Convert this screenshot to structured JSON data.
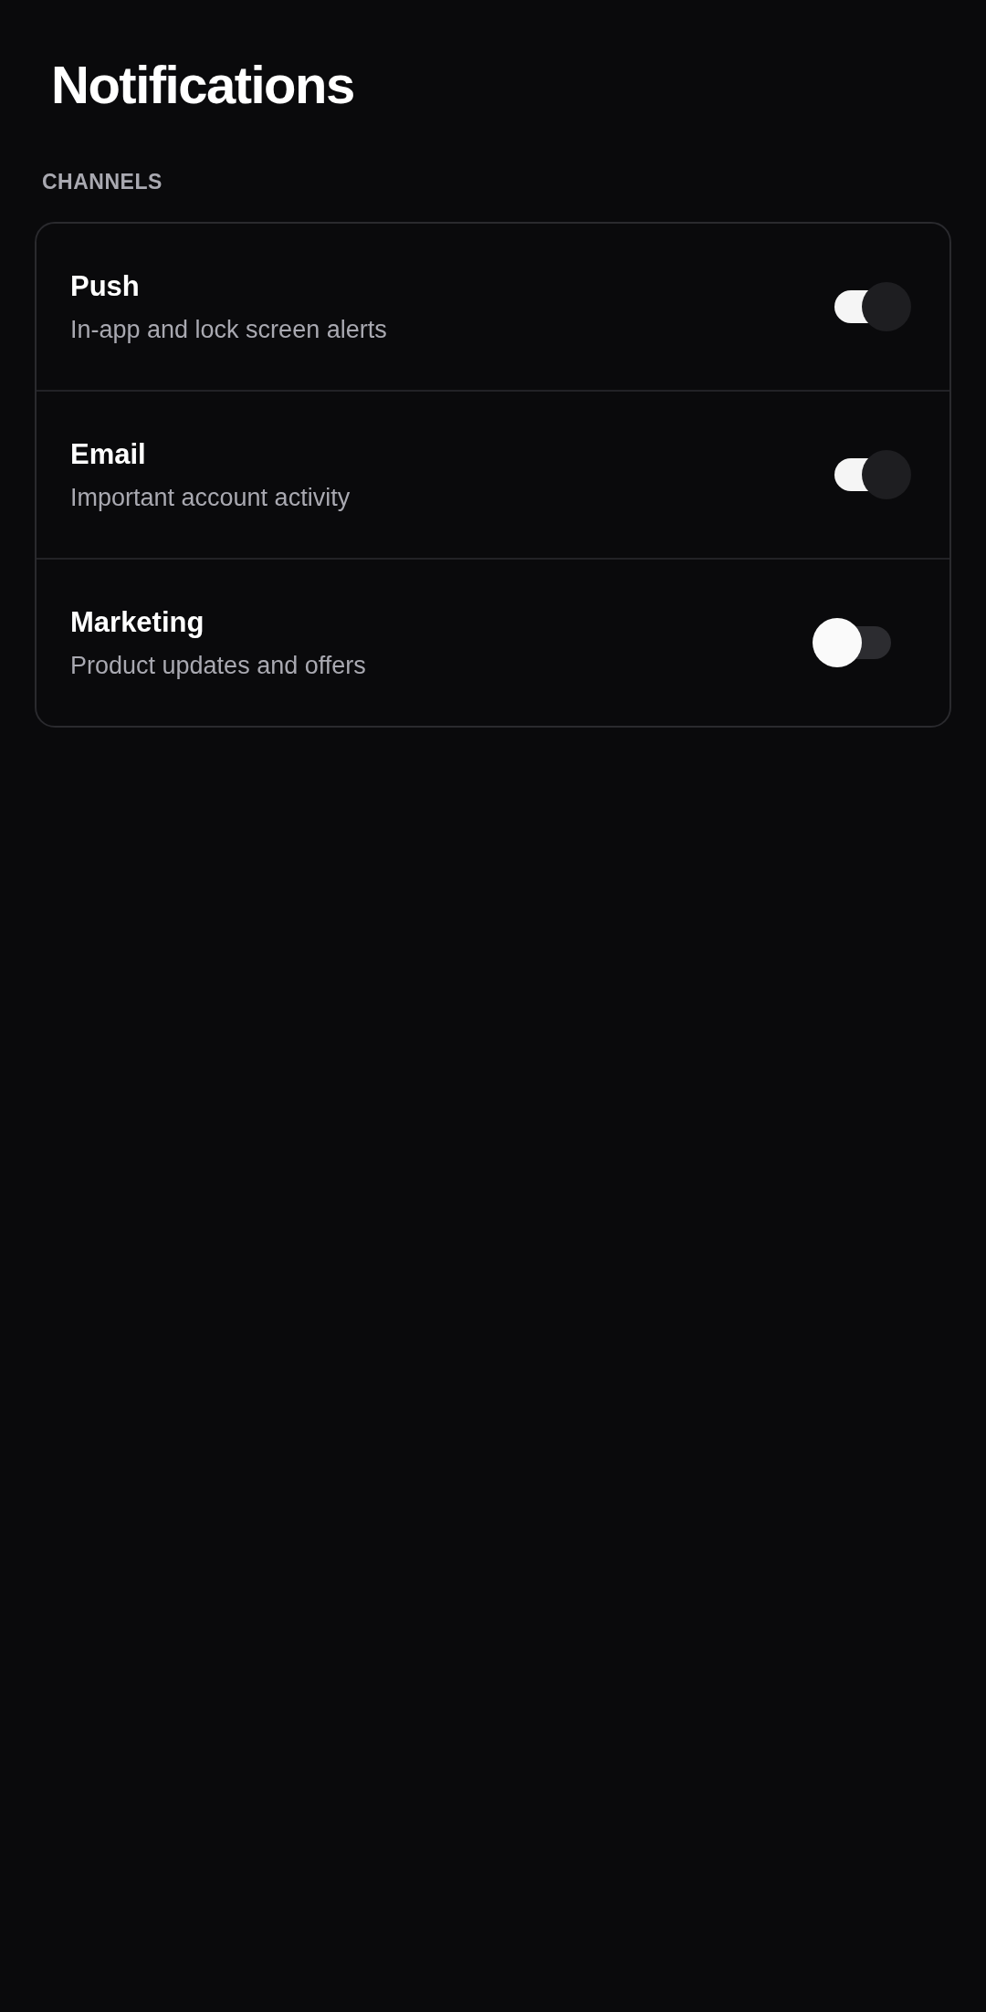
{
  "title": "Notifications",
  "section": "CHANNELS",
  "channels": [
    {
      "title": "Push",
      "subtitle": "In-app and lock screen alerts",
      "on": true
    },
    {
      "title": "Email",
      "subtitle": "Important account activity",
      "on": true
    },
    {
      "title": "Marketing",
      "subtitle": "Product updates and offers",
      "on": false
    }
  ]
}
